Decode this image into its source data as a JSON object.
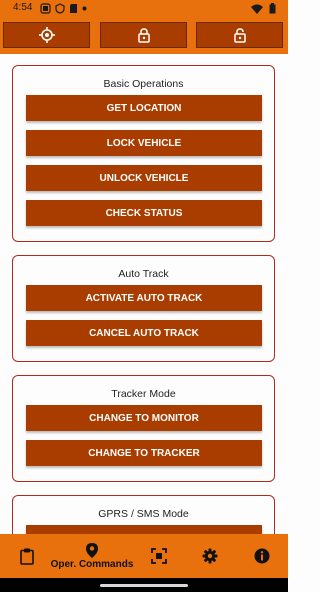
{
  "status_bar": {
    "time": "4:54",
    "left_icons": [
      "signal-status-icon",
      "vpn-icon",
      "sd-card-icon",
      "dot-icon"
    ],
    "right_icons": [
      "wifi-icon",
      "battery-icon"
    ]
  },
  "top_bar": {
    "buttons": [
      {
        "icon": "locate-target-icon"
      },
      {
        "icon": "lock-icon"
      },
      {
        "icon": "unlock-icon"
      }
    ]
  },
  "sections": [
    {
      "title": "Basic Operations",
      "buttons": [
        "GET LOCATION",
        "LOCK VEHICLE",
        "UNLOCK VEHICLE",
        "CHECK STATUS"
      ]
    },
    {
      "title": "Auto Track",
      "buttons": [
        "ACTIVATE AUTO TRACK",
        "CANCEL AUTO TRACK"
      ]
    },
    {
      "title": "Tracker Mode",
      "buttons": [
        "CHANGE TO MONITOR",
        "CHANGE TO TRACKER"
      ]
    },
    {
      "title": "GPRS / SMS Mode",
      "buttons": []
    }
  ],
  "bottom_nav": {
    "items": [
      {
        "icon": "clipboard-icon",
        "label": ""
      },
      {
        "icon": "map-pin-icon",
        "label": "Oper. Commands"
      },
      {
        "icon": "device-frame-icon",
        "label": ""
      },
      {
        "icon": "settings-gear-icon",
        "label": ""
      },
      {
        "icon": "info-icon",
        "label": ""
      }
    ]
  },
  "colors": {
    "accent_orange": "#e8700d",
    "button_brown": "#a93d00",
    "card_border": "#b02a1e"
  }
}
